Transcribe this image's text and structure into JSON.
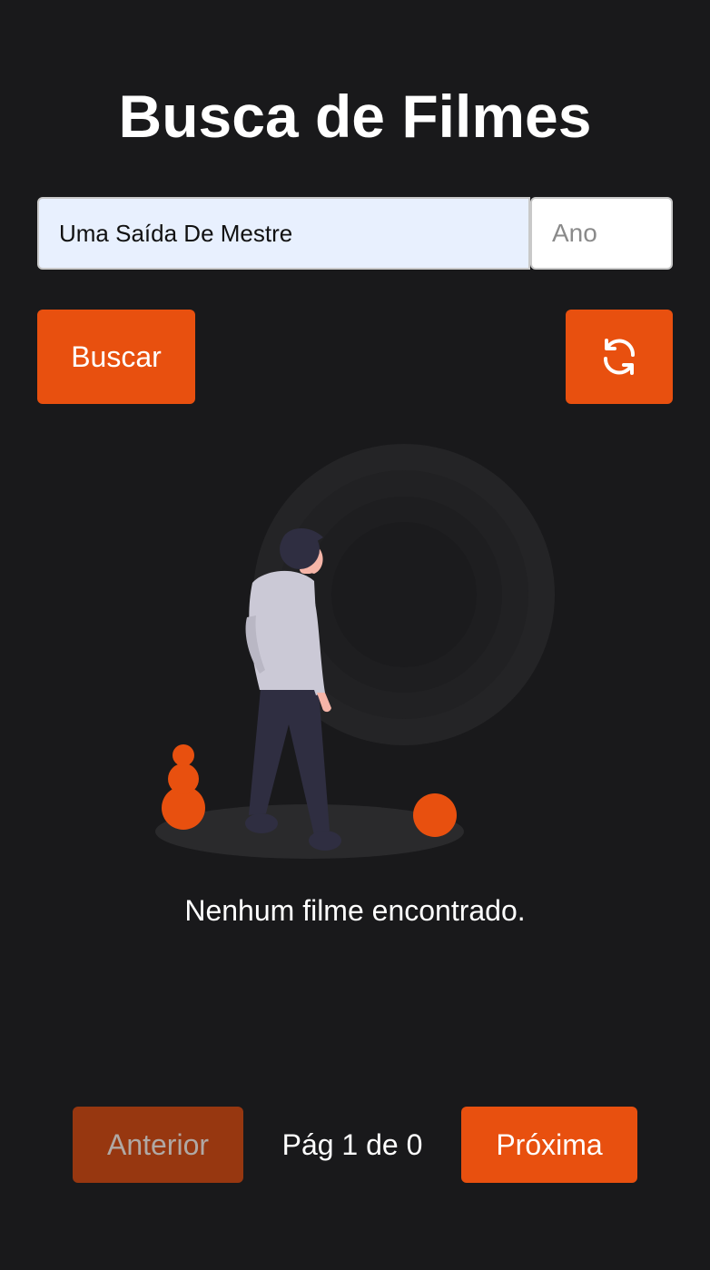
{
  "page": {
    "title": "Busca de Filmes"
  },
  "search": {
    "query_value": "Uma Saída De Mestre",
    "year_placeholder": "Ano",
    "search_button_label": "Buscar"
  },
  "icons": {
    "refresh": "refresh-icon",
    "illustration": "empty-state-illustration"
  },
  "results": {
    "empty_message": "Nenhum filme encontrado."
  },
  "pagination": {
    "prev_label": "Anterior",
    "page_info": "Pág 1 de 0",
    "next_label": "Próxima"
  },
  "colors": {
    "accent": "#e8500f",
    "background": "#19191b",
    "accent_disabled": "#973710"
  }
}
